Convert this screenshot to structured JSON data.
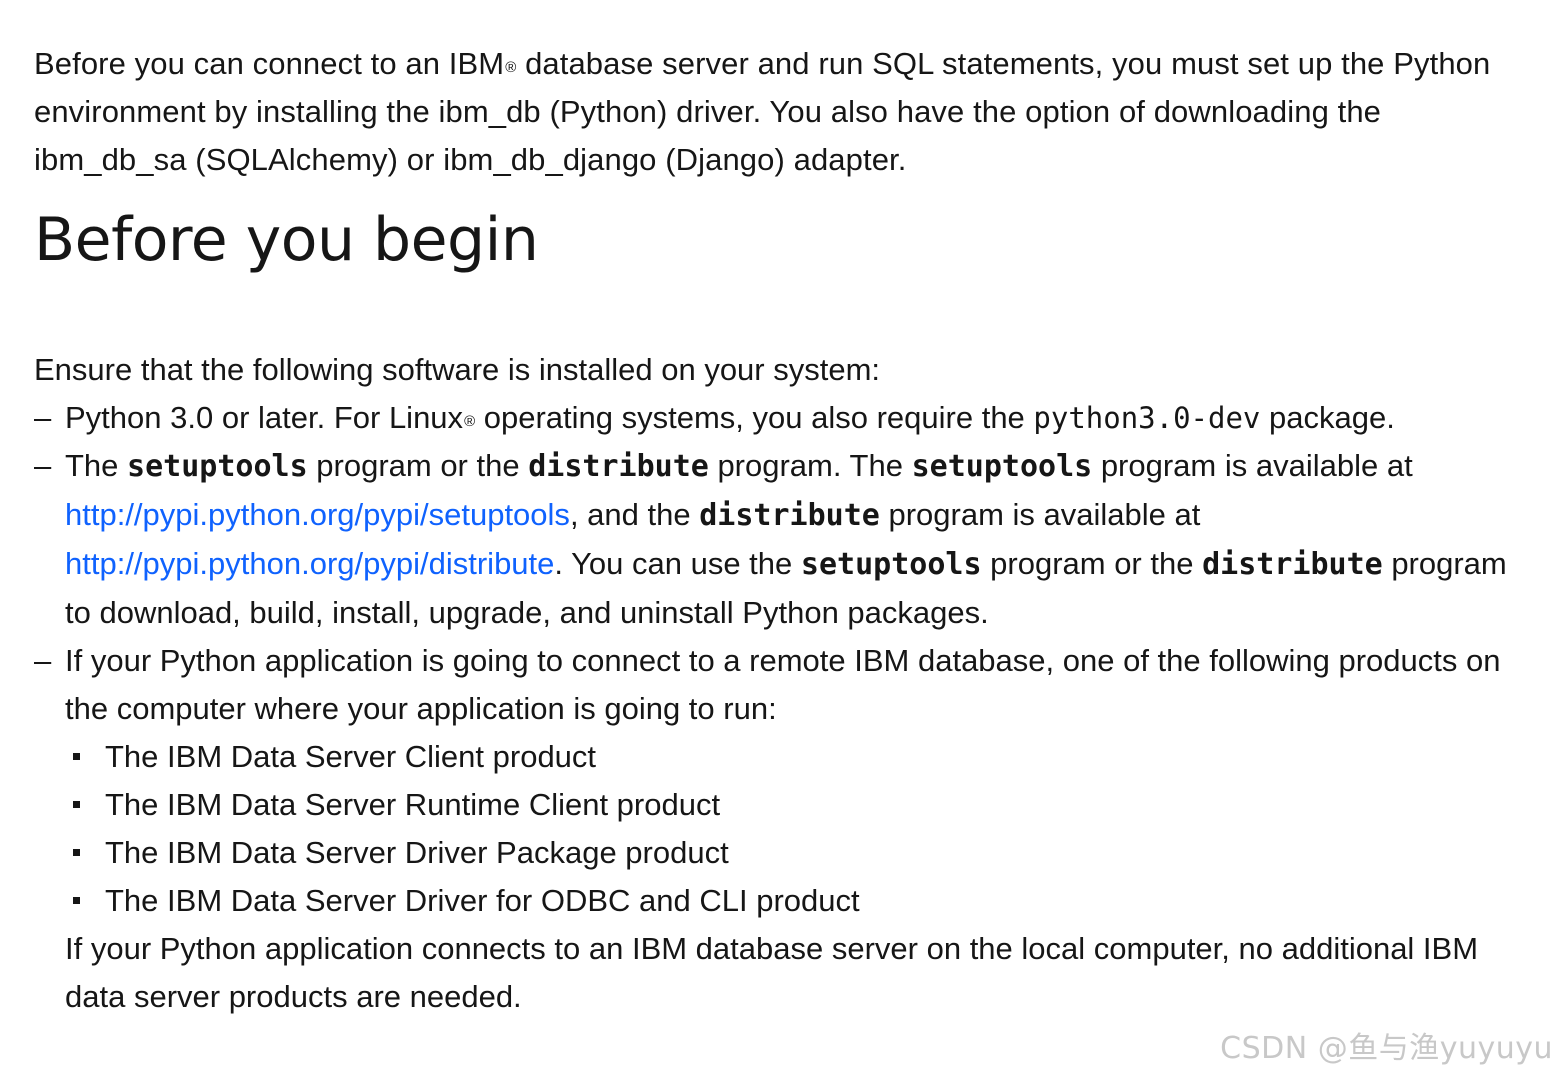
{
  "intro": {
    "part1": "Before you can connect to an IBM",
    "reg": "®",
    "part2": " database server and run SQL statements, you must set up the Python environment by installing the ibm_db (Python) driver. You also have the option of downloading the ibm_db_sa (SQLAlchemy) or ibm_db_django (Django) adapter."
  },
  "heading": "Before you begin",
  "ensure": "Ensure that the following software is installed on your system:",
  "dash": "–",
  "item1": {
    "a": "Python 3.0 or later. For Linux",
    "reg": "®",
    "b": " operating systems, you also require the ",
    "code": "python3.0-dev",
    "c": " package."
  },
  "item2": {
    "a": "The ",
    "code1": "setuptools",
    "b": " program or the ",
    "code2": "distribute",
    "c": " program. The ",
    "code3": "setuptools",
    "d": " program is available at ",
    "link1": "http://pypi.python.org/pypi/setuptools",
    "e": ", and the ",
    "code4": "distribute",
    "f": " program is available at ",
    "link2": "http://pypi.python.org/pypi/distribute",
    "g": ". You can use the ",
    "code5": "setuptools",
    "h": " program or the ",
    "code6": "distribute",
    "i": " program to download, build, install, upgrade, and uninstall Python packages."
  },
  "item3": {
    "text": "If your Python application is going to connect to a remote IBM database, one of the following products on the computer where your application is going to run:",
    "products": [
      "The IBM Data Server Client product",
      "The IBM Data Server Runtime Client product",
      "The IBM Data Server Driver Package product",
      "The IBM Data Server Driver for ODBC and CLI product"
    ],
    "note": "If your Python application connects to an IBM database server on the local computer, no additional IBM data server products are needed."
  },
  "watermark": "CSDN @鱼与渔yuyuyu"
}
